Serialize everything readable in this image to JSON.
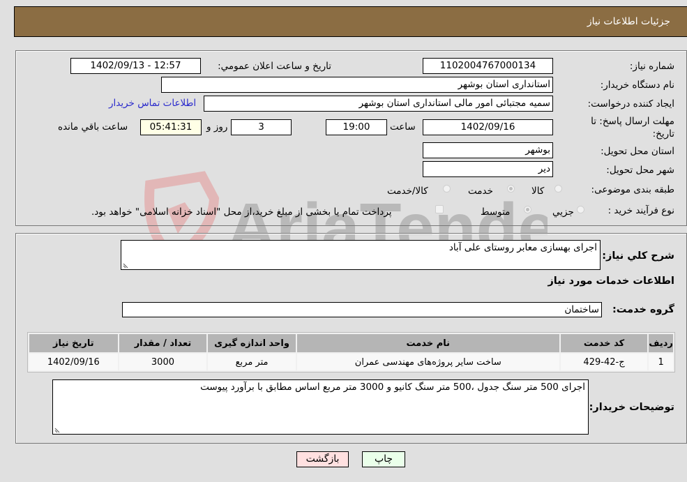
{
  "header": {
    "title": "جزئیات اطلاعات نیاز"
  },
  "form": {
    "need_number": {
      "label": "شماره نیاز:",
      "value": "1102004767000134"
    },
    "announce_datetime": {
      "label": "تاریخ و ساعت اعلان عمومي:",
      "value": "1402/09/13 - 12:57"
    },
    "buyer_org": {
      "label": "نام دستگاه خریدار:",
      "value": "استانداری استان بوشهر"
    },
    "creator": {
      "label": "ایجاد کننده درخواست:",
      "value": "سمیه مجتبائی امور مالی استانداری استان بوشهر"
    },
    "buyer_contact_link": "اطلاعات تماس خریدار",
    "deadline": {
      "label_line1": "مهلت ارسال پاسخ: تا",
      "label_line2": "تاریخ:",
      "date": "1402/09/16",
      "time_label": "ساعت",
      "time": "19:00",
      "days": "3",
      "days_label": "روز و",
      "remaining": "05:41:31",
      "remaining_label": "ساعت باقي مانده"
    },
    "province": {
      "label": "استان محل تحویل:",
      "value": "بوشهر"
    },
    "city": {
      "label": "شهر محل تحویل:",
      "value": "دیر"
    },
    "category": {
      "label": "طبقه بندی موضوعی:",
      "options": [
        {
          "label": "کالا",
          "checked": false
        },
        {
          "label": "خدمت",
          "checked": true
        },
        {
          "label": "کالا/خدمت",
          "checked": false
        }
      ]
    },
    "process": {
      "label": "نوع فرآیند خرید :",
      "options": [
        {
          "label": "جزيي",
          "checked": false
        },
        {
          "label": "متوسط",
          "checked": true
        }
      ],
      "treasury_checkbox": {
        "label": "پرداخت تمام یا بخشی از مبلغ خرید،از محل \"اسناد خزانه اسلامی\" خواهد بود.",
        "checked": false
      }
    }
  },
  "summary": {
    "label": "شرح کلي نیاز:",
    "value": "اجرای بهسازی معابر روستای علی آباد"
  },
  "services_section": {
    "title": "اطلاعات خدمات مورد نیاز",
    "group_label": "گروه خدمت:",
    "group_value": "ساختمان"
  },
  "table": {
    "columns": [
      "ردیف",
      "کد خدمت",
      "نام خدمت",
      "واحد اندازه گیری",
      "تعداد / مقدار",
      "تاریخ نیاز"
    ],
    "rows": [
      [
        "1",
        "ج-42-429",
        "ساخت سایر پروژه‌های مهندسی عمران",
        "متر مربع",
        "3000",
        "1402/09/16"
      ]
    ]
  },
  "buyer_notes": {
    "label": "توضیحات خریدار:",
    "value": "اجرای 500 متر سنگ جدول ،500 متر سنگ کانیو و 3000 متر مربع اساس مطابق با برآورد پیوست"
  },
  "buttons": {
    "print": "چاپ",
    "back": "بازگشت"
  },
  "watermark": {
    "text": "AriaTender.neT"
  },
  "colors": {
    "header_bg": "#8b6d43",
    "link": "#2a2acc",
    "back_btn": "#ffe0e0",
    "print_btn": "#eaffea",
    "remaining_bg": "#ffffe6"
  }
}
